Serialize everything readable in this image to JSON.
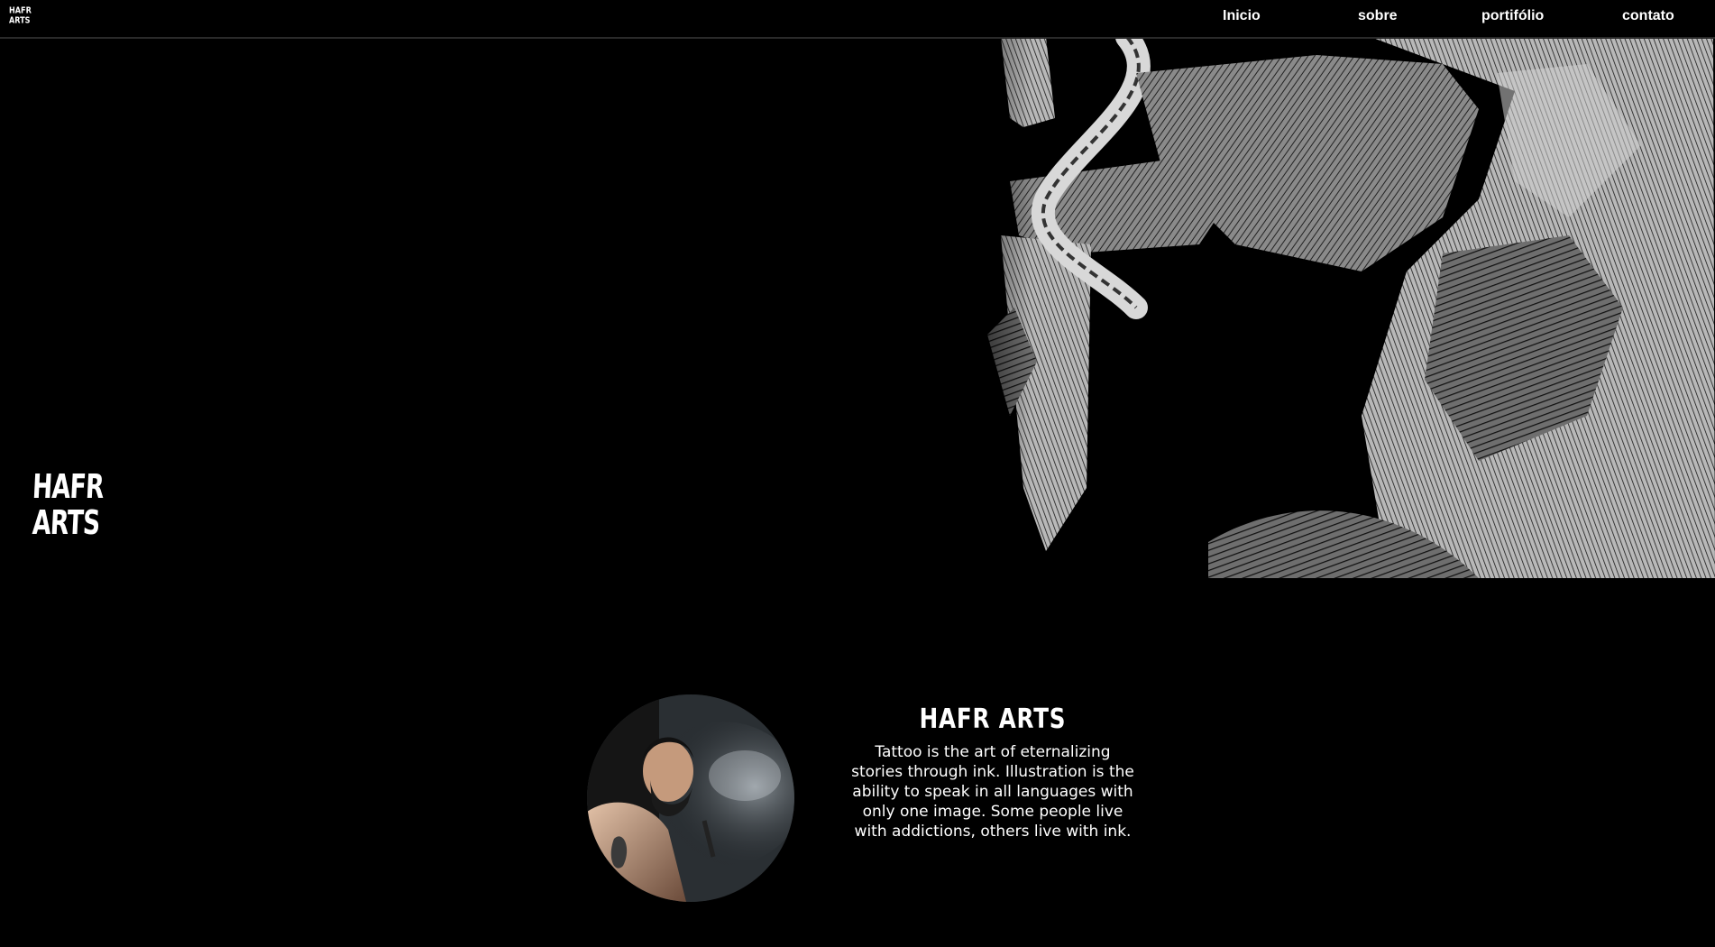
{
  "header": {
    "logo_line1": "HAFR",
    "logo_line2": "ARTS",
    "nav": [
      {
        "label": "Inicio"
      },
      {
        "label": "sobre"
      },
      {
        "label": "portifólio"
      },
      {
        "label": "contato"
      }
    ]
  },
  "hero": {
    "logo_line1": "HAFR",
    "logo_line2": "ARTS",
    "artwork_icon": "sword-illustration-icon"
  },
  "about": {
    "photo_icon": "artist-portrait-icon",
    "title": "HAFR ARTS",
    "body": "Tattoo is the art of eternalizing stories through ink. Illustration is the ability to speak in all languages with only one image. Some people live with addictions, others live with ink."
  },
  "colors": {
    "background": "#000000",
    "text": "#ffffff",
    "divider": "#2a2a2a"
  }
}
